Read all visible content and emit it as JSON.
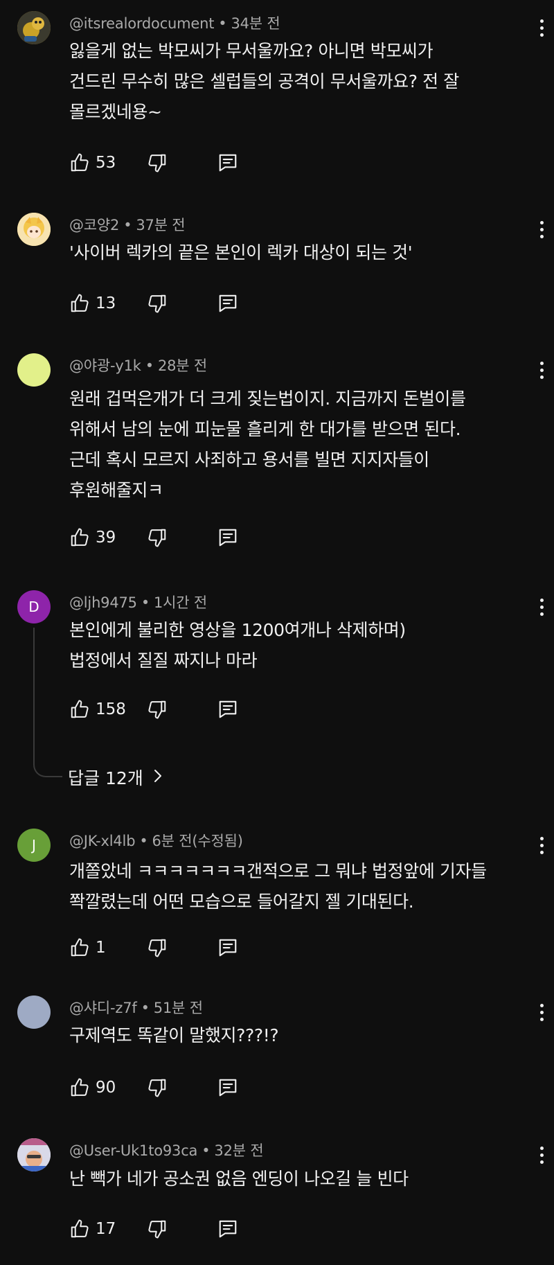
{
  "comments": [
    {
      "author": "@itsrealordocument",
      "time": "34분 전",
      "lines": [
        "잃을게 없는 박모씨가 무서울까요? 아니면 박모씨가",
        "건드린 무수히 많은 셀럽들의 공격이 무서울까요? 전 잘",
        "몰르겠네용~"
      ],
      "likes": "53",
      "avatar": {
        "type": "image",
        "color": "#c9a227",
        "icon": "cartoon-avatar-icon"
      }
    },
    {
      "author": "@코양2",
      "time": "37분 전",
      "lines": [
        "'사이버 렉카의 끝은 본인이 렉카 대상이 되는 것'"
      ],
      "likes": "13",
      "avatar": {
        "type": "image",
        "color": "#f3c64b",
        "icon": "anime-avatar-icon"
      }
    },
    {
      "author": "@야광-y1k",
      "time": "28분 전",
      "lines": [
        "원래 겁먹은개가 더 크게 짖는법이지. 지금까지 돈벌이를",
        "위해서 남의 눈에 피눈물 흘리게 한 대가를 받으면 된다.",
        "근데 혹시 모르지 사죄하고 용서를 빌면 지지자들이",
        "후원해줄지ㅋ"
      ],
      "likes": "39",
      "avatar": {
        "type": "solid",
        "color": "#e2f08a"
      }
    },
    {
      "author": "@ljh9475",
      "time": "1시간 전",
      "lines": [
        "본인에게 불리한 영상을 1200여개나 삭제하며)",
        "법정에서 질질 짜지나 마라"
      ],
      "likes": "158",
      "avatar": {
        "type": "letter",
        "letter": "D",
        "color": "#8e24aa"
      },
      "replies_label": "답글 12개"
    },
    {
      "author": "@JK-xl4lb",
      "time": "6분 전(수정됨)",
      "lines": [
        "개쫄았네 ㅋㅋㅋㅋㅋㅋㅋ갠적으로 그 뭐냐 법정앞에 기자들",
        "쫙깔렸는데 어떤 모습으로 들어갈지 젤 기대된다."
      ],
      "likes": "1",
      "avatar": {
        "type": "letter",
        "letter": "J",
        "color": "#689f38"
      }
    },
    {
      "author": "@샤디-z7f",
      "time": "51분 전",
      "lines": [
        "구제역도 똑같이 말했지???!?"
      ],
      "likes": "90",
      "avatar": {
        "type": "solid",
        "color": "#9eaac4"
      }
    },
    {
      "author": "@User-Uk1to93ca",
      "time": "32분 전",
      "lines": [
        "난 빽가 네가 공소권 없음 엔딩이 나오길 늘  빈다"
      ],
      "likes": "17",
      "avatar": {
        "type": "image",
        "color": "#d9d9e8",
        "icon": "meme-avatar-icon"
      }
    }
  ],
  "icons": {
    "like": "thumbs-up-icon",
    "dislike": "thumbs-down-icon",
    "reply": "reply-comment-icon",
    "more": "more-vertical-icon",
    "chevron": "chevron-right-icon"
  }
}
